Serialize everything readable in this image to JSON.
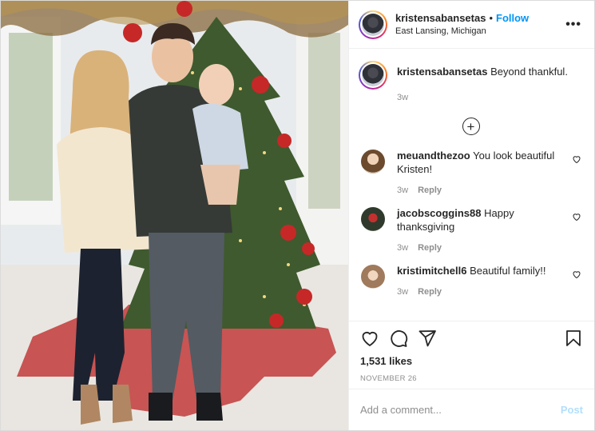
{
  "post": {
    "username": "kristensabansetas",
    "follow_label": "Follow",
    "separator": "•",
    "location": "East Lansing, Michigan",
    "more_label": "•••"
  },
  "caption": {
    "username": "kristensabansetas",
    "text": "Beyond thankful.",
    "time": "3w"
  },
  "load_more_label": "+",
  "comments": [
    {
      "username": "meuandthezoo",
      "text": "You look beautiful Kristen!",
      "time": "3w",
      "reply_label": "Reply",
      "avatar_color": "#b88a5a"
    },
    {
      "username": "jacobscoggins88",
      "text": "Happy thanksgiving",
      "time": "3w",
      "reply_label": "Reply",
      "avatar_color": "#3e4a3a"
    },
    {
      "username": "kristimitchell6",
      "text": "Beautiful family!!",
      "time": "3w",
      "reply_label": "Reply",
      "avatar_color": "#c9a88e"
    }
  ],
  "actions": {
    "likes": "1,531 likes",
    "date": "NOVEMBER 26",
    "icons": [
      "heart-icon",
      "comment-icon",
      "share-icon",
      "bookmark-icon"
    ]
  },
  "add_comment": {
    "placeholder": "Add a comment...",
    "post_label": "Post"
  },
  "colors": {
    "accent": "#0095f6",
    "post_disabled": "#b2dffc",
    "muted": "#8e8e8e"
  }
}
